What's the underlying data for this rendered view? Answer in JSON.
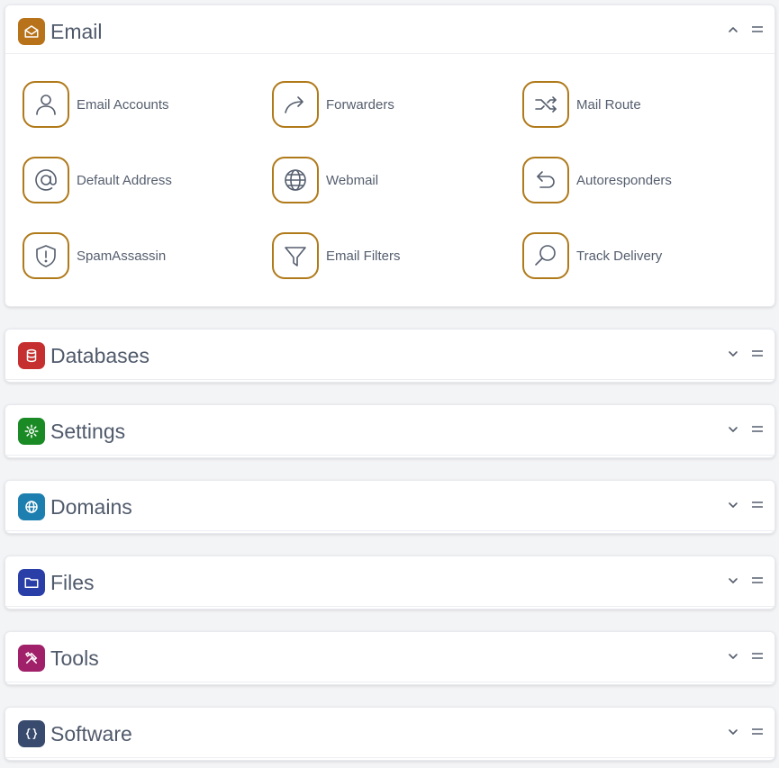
{
  "sections": [
    {
      "id": "email",
      "title": "Email",
      "icon": "envelope-open-icon",
      "color": "#b8731a",
      "expanded": true
    },
    {
      "id": "databases",
      "title": "Databases",
      "icon": "database-icon",
      "color": "#c62f2f",
      "expanded": false
    },
    {
      "id": "settings",
      "title": "Settings",
      "icon": "gear-icon",
      "color": "#1a8a24",
      "expanded": false
    },
    {
      "id": "domains",
      "title": "Domains",
      "icon": "globe-icon",
      "color": "#1d7fb0",
      "expanded": false
    },
    {
      "id": "files",
      "title": "Files",
      "icon": "folder-icon",
      "color": "#2a3ea8",
      "expanded": false
    },
    {
      "id": "tools",
      "title": "Tools",
      "icon": "tools-icon",
      "color": "#a1206a",
      "expanded": false
    },
    {
      "id": "software",
      "title": "Software",
      "icon": "code-braces-icon",
      "color": "#384a6e",
      "expanded": false
    }
  ],
  "email_items": [
    {
      "label": "Email Accounts",
      "icon": "user-icon"
    },
    {
      "label": "Forwarders",
      "icon": "forward-arrow-icon"
    },
    {
      "label": "Mail Route",
      "icon": "shuffle-arrows-icon"
    },
    {
      "label": "Default Address",
      "icon": "at-sign-icon"
    },
    {
      "label": "Webmail",
      "icon": "globe-icon"
    },
    {
      "label": "Autoresponders",
      "icon": "return-arrow-icon"
    },
    {
      "label": "SpamAssassin",
      "icon": "shield-alert-icon"
    },
    {
      "label": "Email Filters",
      "icon": "filter-icon"
    },
    {
      "label": "Track Delivery",
      "icon": "search-icon"
    }
  ],
  "colors": {
    "item_border": "#b07a1a",
    "item_icon": "#555e6e"
  }
}
